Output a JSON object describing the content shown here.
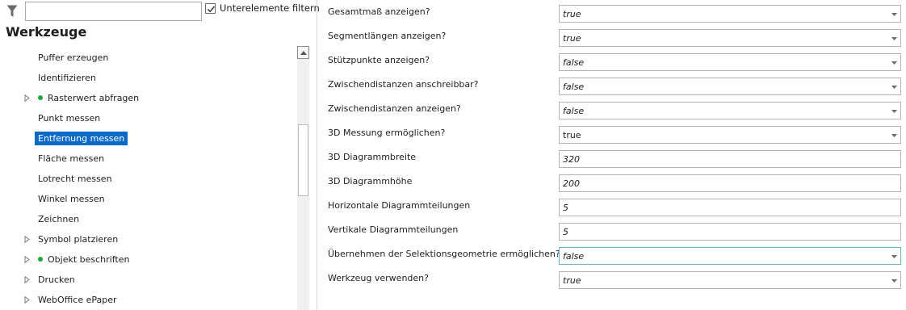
{
  "filter": {
    "icon": "filter-icon",
    "search_value": "",
    "sub_filter_checked": true,
    "sub_filter_label": "Unterelemente filtern"
  },
  "tree": {
    "title": "Werkzeuge",
    "items": [
      {
        "label": "Puffer erzeugen",
        "expandable": false,
        "dot": false,
        "selected": false
      },
      {
        "label": "Identifizieren",
        "expandable": false,
        "dot": false,
        "selected": false
      },
      {
        "label": "Rasterwert abfragen",
        "expandable": true,
        "dot": true,
        "selected": false
      },
      {
        "label": "Punkt messen",
        "expandable": false,
        "dot": false,
        "selected": false
      },
      {
        "label": "Entfernung messen",
        "expandable": false,
        "dot": false,
        "selected": true
      },
      {
        "label": "Fläche messen",
        "expandable": false,
        "dot": false,
        "selected": false
      },
      {
        "label": "Lotrecht messen",
        "expandable": false,
        "dot": false,
        "selected": false
      },
      {
        "label": "Winkel messen",
        "expandable": false,
        "dot": false,
        "selected": false
      },
      {
        "label": "Zeichnen",
        "expandable": false,
        "dot": false,
        "selected": false
      },
      {
        "label": "Symbol platzieren",
        "expandable": true,
        "dot": false,
        "selected": false
      },
      {
        "label": "Objekt beschriften",
        "expandable": true,
        "dot": true,
        "selected": false
      },
      {
        "label": "Drucken",
        "expandable": true,
        "dot": false,
        "selected": false
      },
      {
        "label": "WebOffice ePaper",
        "expandable": true,
        "dot": false,
        "selected": false
      }
    ]
  },
  "properties": [
    {
      "label": "Gesamtmaß anzeigen?",
      "value": "true",
      "type": "dropdown",
      "italic": true
    },
    {
      "label": "Segmentlängen anzeigen?",
      "value": "true",
      "type": "dropdown",
      "italic": true
    },
    {
      "label": "Stützpunkte anzeigen?",
      "value": "false",
      "type": "dropdown",
      "italic": true
    },
    {
      "label": "Zwischendistanzen anschreibbar?",
      "value": "false",
      "type": "dropdown",
      "italic": true
    },
    {
      "label": "Zwischendistanzen anzeigen?",
      "value": "false",
      "type": "dropdown",
      "italic": true
    },
    {
      "label": "3D Messung ermöglichen?",
      "value": "true",
      "type": "dropdown",
      "italic": false
    },
    {
      "label": "3D Diagrammbreite",
      "value": "320",
      "type": "text",
      "italic": true
    },
    {
      "label": "3D Diagrammhöhe",
      "value": "200",
      "type": "text",
      "italic": true
    },
    {
      "label": "Horizontale Diagrammteilungen",
      "value": "5",
      "type": "text",
      "italic": true
    },
    {
      "label": "Vertikale Diagrammteilungen",
      "value": "5",
      "type": "text",
      "italic": true
    },
    {
      "label": "Übernehmen der Selektionsgeometrie ermöglichen?",
      "value": "false",
      "type": "dropdown",
      "italic": true,
      "focused": true
    },
    {
      "label": "Werkzeug verwenden?",
      "value": "true",
      "type": "dropdown",
      "italic": true
    }
  ],
  "colors": {
    "selection": "#0a6bc6",
    "status_dot": "#1fa83a",
    "focus_border": "#6fb3c8"
  }
}
